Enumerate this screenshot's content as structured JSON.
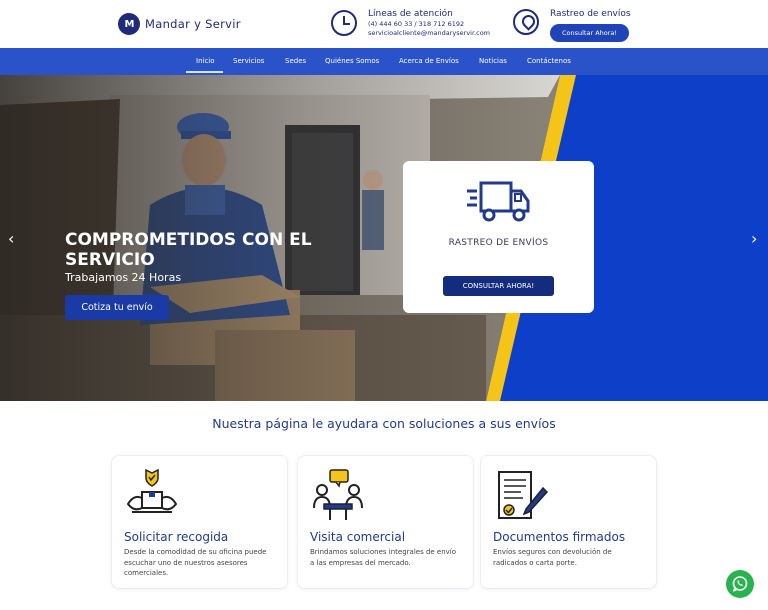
{
  "header": {
    "logo_mark": "M",
    "logo_text": "Mandar y Servir",
    "contact_title": "Líneas de atención",
    "contact_phones": "(4) 444 60 33 / 318 712 6192",
    "contact_email": "servicioalcliente@mandaryservir.com",
    "track_title": "Rastreo de envíos",
    "track_button": "Consultar Ahora!"
  },
  "nav": {
    "items": [
      "Inicio",
      "Servicios",
      "Sedes",
      "Quiénes Somos",
      "Acerca de Envíos",
      "Noticias",
      "Contáctenos"
    ],
    "active": "Inicio"
  },
  "hero": {
    "title": "COMPROMETIDOS CON EL SERVICIO",
    "subtitle": "Trabajamos 24 Horas",
    "cta": "Cotiza tu envío",
    "prev_arrow": "‹",
    "next_arrow": "›",
    "card_title": "RASTREO DE ENVÍOS",
    "card_button": "CONSULTAR AHORA!"
  },
  "section": {
    "title": "Nuestra página le ayudara con soluciones a sus envíos",
    "cards": [
      {
        "title": "Solicitar recogida",
        "desc": "Desde la comodidad de su oficina puede escuchar uno de nuestros asesores comerciales.",
        "icon": "package-pickup-icon"
      },
      {
        "title": "Visita comercial",
        "desc": "Brindamos soluciones integrales de envío a las empresas del mercado.",
        "icon": "meeting-icon"
      },
      {
        "title": "Documentos firmados",
        "desc": "Envíos seguros con devolución de radicados o carta porte.",
        "icon": "signed-document-icon"
      }
    ]
  },
  "colors": {
    "brand_navy": "#1f2b7a",
    "nav_blue": "#2a52c9",
    "hero_blue": "#0e3fc9",
    "accent_yellow": "#f4c518",
    "whatsapp_green": "#2ab24f"
  }
}
